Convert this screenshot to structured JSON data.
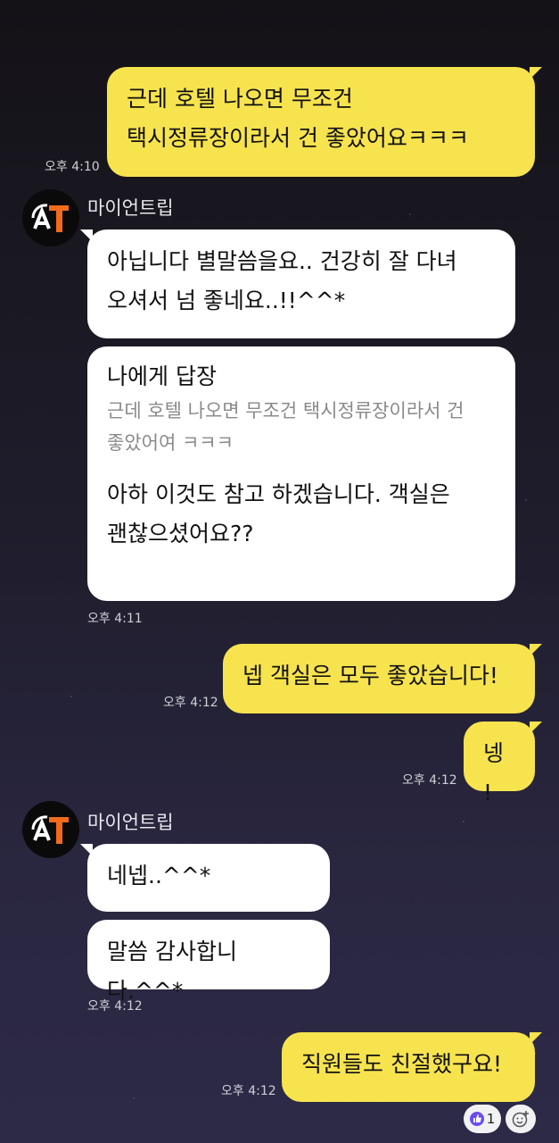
{
  "messages": {
    "m1": {
      "text": "근데 호텔 나오면 무조건\n택시정류장이라서 건 좋았어요ㅋㅋㅋ",
      "time": "오후 4:10"
    },
    "sender1": "마이언트립",
    "m2": {
      "text": "아닙니다 별말씀을요.. 건강히 잘 다녀\n오셔서 넘 좋네요..!!^^*"
    },
    "m3": {
      "reply_title": "나에게 답장",
      "reply_quote": "근데 호텔 나오면 무조건 택시정류장이라서 건\n좋았어여 ㅋㅋㅋ",
      "text": "아하 이것도 참고 하겠습니다. 객실은\n괜찮으셨어요??",
      "time": "오후 4:11"
    },
    "m4": {
      "text": "넵 객실은 모두 좋았습니다!",
      "time": "오후 4:12"
    },
    "m5": {
      "text": "넹 !",
      "time": "오후 4:12"
    },
    "sender2": "마이언트립",
    "m6": {
      "text": "네넵..^^*"
    },
    "m7": {
      "text": "말씀 감사합니다.^^*",
      "time": "오후 4:12"
    },
    "m8": {
      "text": "직원들도 친절했구요!",
      "time": "오후 4:12"
    }
  },
  "reactions": {
    "like_count": "1"
  },
  "icons": {
    "like": "thumbs-up-icon",
    "add_reaction": "add-emoji-icon",
    "avatar": "mytrip-logo"
  },
  "colors": {
    "my_bubble": "#f7e34e",
    "their_bubble": "#ffffff",
    "logo_orange": "#f26b1d"
  }
}
